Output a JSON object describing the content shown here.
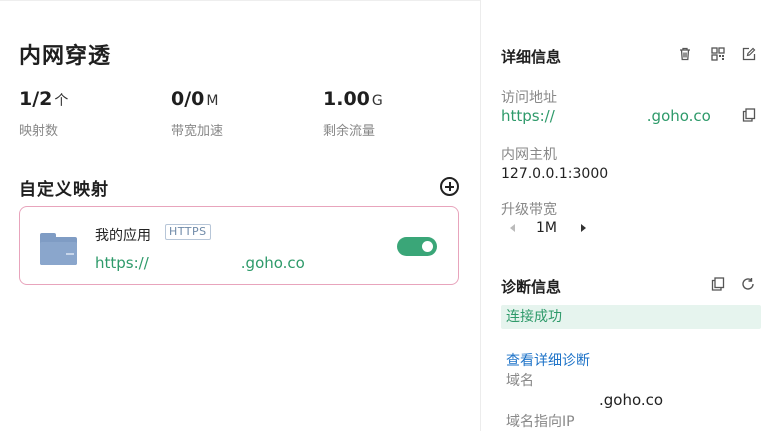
{
  "left": {
    "title": "内网穿透",
    "stats": [
      {
        "value": "1/2",
        "unit": "个",
        "label": "映射数"
      },
      {
        "value": "0/0",
        "unit": "M",
        "label": "带宽加速"
      },
      {
        "value": "1.00",
        "unit": "G",
        "label": "剩余流量"
      }
    ],
    "section_title": "自定义映射",
    "card": {
      "name": "我的应用",
      "badge": "HTTPS",
      "url_prefix": "https://",
      "url_suffix": ".goho.co",
      "enabled": true
    }
  },
  "right": {
    "details_title": "详细信息",
    "access_label": "访问地址",
    "access_url_prefix": "https://",
    "access_url_suffix": ".goho.co",
    "host_label": "内网主机",
    "host_value": "127.0.0.1:3000",
    "bandwidth_label": "升级带宽",
    "bandwidth_value": "1M",
    "diag_title": "诊断信息",
    "diag_status": "连接成功",
    "diag_link": "查看详细诊断",
    "domain_label": "域名",
    "domain_value": ".goho.co",
    "domain_ip_label": "域名指向IP"
  },
  "colors": {
    "accent_green": "#2e9a6a",
    "toggle_green": "#3aa678",
    "card_border": "#e8a4bc",
    "link_blue": "#1e73c8"
  }
}
